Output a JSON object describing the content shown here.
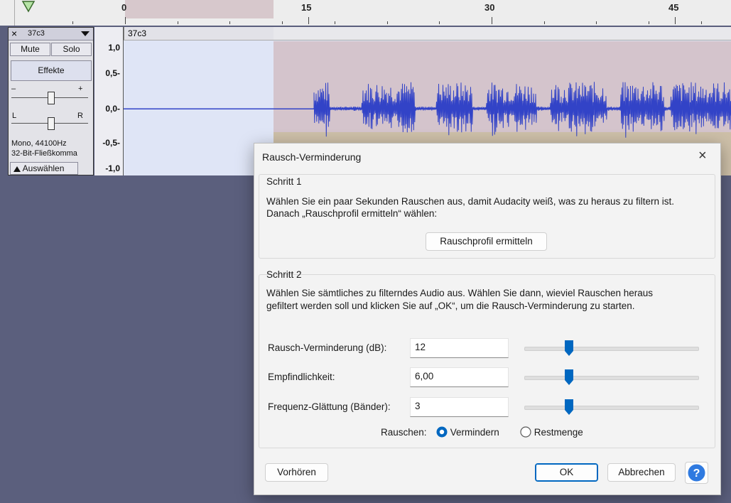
{
  "ruler": {
    "labels": [
      "0",
      "15",
      "30",
      "45"
    ]
  },
  "track": {
    "name": "37c3",
    "mute_label": "Mute",
    "solo_label": "Solo",
    "effects_label": "Effekte",
    "gain_minus": "–",
    "gain_plus": "+",
    "pan_left": "L",
    "pan_right": "R",
    "info_line1": "Mono, 44100Hz",
    "info_line2": "32-Bit-Fließkomma",
    "select_label": "Auswählen",
    "clip_name": "37c3",
    "vruler": [
      "1,0",
      "0,5-",
      "0,0-",
      "-0,5-",
      "-1,0"
    ]
  },
  "dialog": {
    "title": "Rausch-Verminderung",
    "step1": {
      "heading": "Schritt 1",
      "text_line1": "Wählen Sie ein paar Sekunden Rauschen aus, damit Audacity weiß, was zu heraus zu filtern ist.",
      "text_line2": "Danach „Rauschprofil ermitteln“ wählen:",
      "button": "Rauschprofil ermitteln"
    },
    "step2": {
      "heading": "Schritt 2",
      "text_line1": "Wählen Sie sämtliches zu filterndes Audio aus. Wählen Sie dann, wieviel Rauschen heraus",
      "text_line2": "gefiltert werden soll und klicken Sie auf „OK“, um die Rausch-Verminderung zu starten.",
      "params": [
        {
          "label": "Rausch-Verminderung (dB):",
          "value": "12",
          "level": 0.26
        },
        {
          "label": "Empfindlichkeit:",
          "value": "6,00",
          "level": 0.26
        },
        {
          "label": "Frequenz-Glättung (Bänder):",
          "value": "3",
          "level": 0.26
        }
      ],
      "noise_label": "Rauschen:",
      "option_reduce": "Vermindern",
      "option_residue": "Restmenge",
      "selected": "Vermindern"
    },
    "preview_button": "Vorhören",
    "ok_button": "OK",
    "cancel_button": "Abbrechen",
    "help_button": "?",
    "close_icon": "×"
  },
  "colors": {
    "accent": "#0067c0",
    "waveform": "#3243c7",
    "selection": "#d4c4cc"
  }
}
